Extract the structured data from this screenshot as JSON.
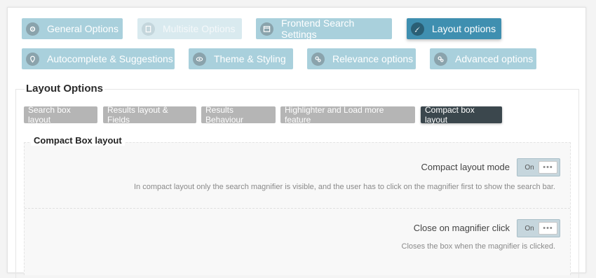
{
  "main_tabs": [
    {
      "label": "General Options",
      "state": "normal",
      "icon": "gear-icon"
    },
    {
      "label": "Multisite Options",
      "state": "disabled",
      "icon": "document-icon"
    },
    {
      "label": "Frontend Search Settings",
      "state": "normal",
      "icon": "window-icon"
    },
    {
      "label": "Layout options",
      "state": "active",
      "icon": "brush-icon"
    },
    {
      "label": "Autocomplete & Suggestions",
      "state": "normal",
      "icon": "pin-icon"
    },
    {
      "label": "Theme & Styling",
      "state": "normal",
      "icon": "eye-icon"
    },
    {
      "label": "Relevance options",
      "state": "normal",
      "icon": "gears-icon"
    },
    {
      "label": "Advanced options",
      "state": "normal",
      "icon": "gears-icon"
    }
  ],
  "section_title": "Layout Options",
  "sub_tabs": [
    {
      "label": "Search box layout"
    },
    {
      "label": "Results layout & Fields"
    },
    {
      "label": "Results Behaviour"
    },
    {
      "label": "Highlighter and Load more feature"
    },
    {
      "label": "Compact box layout",
      "active": true
    }
  ],
  "inner_title": "Compact Box layout",
  "options": [
    {
      "label": "Compact layout mode",
      "toggle_text": "On",
      "knob_text": "•••",
      "description": "In compact layout only the search magnifier is visible, and the user has to click on the magnifier first to show the search bar."
    },
    {
      "label": "Close on magnifier click",
      "toggle_text": "On",
      "knob_text": "•••",
      "description": "Closes the box when the magnifier is clicked."
    }
  ],
  "colors": {
    "tab_bg": "#a9d0dc",
    "tab_active_bg": "#3f8fb0",
    "subtab_bg": "#b5b5b5",
    "subtab_active_bg": "#3b474d"
  }
}
